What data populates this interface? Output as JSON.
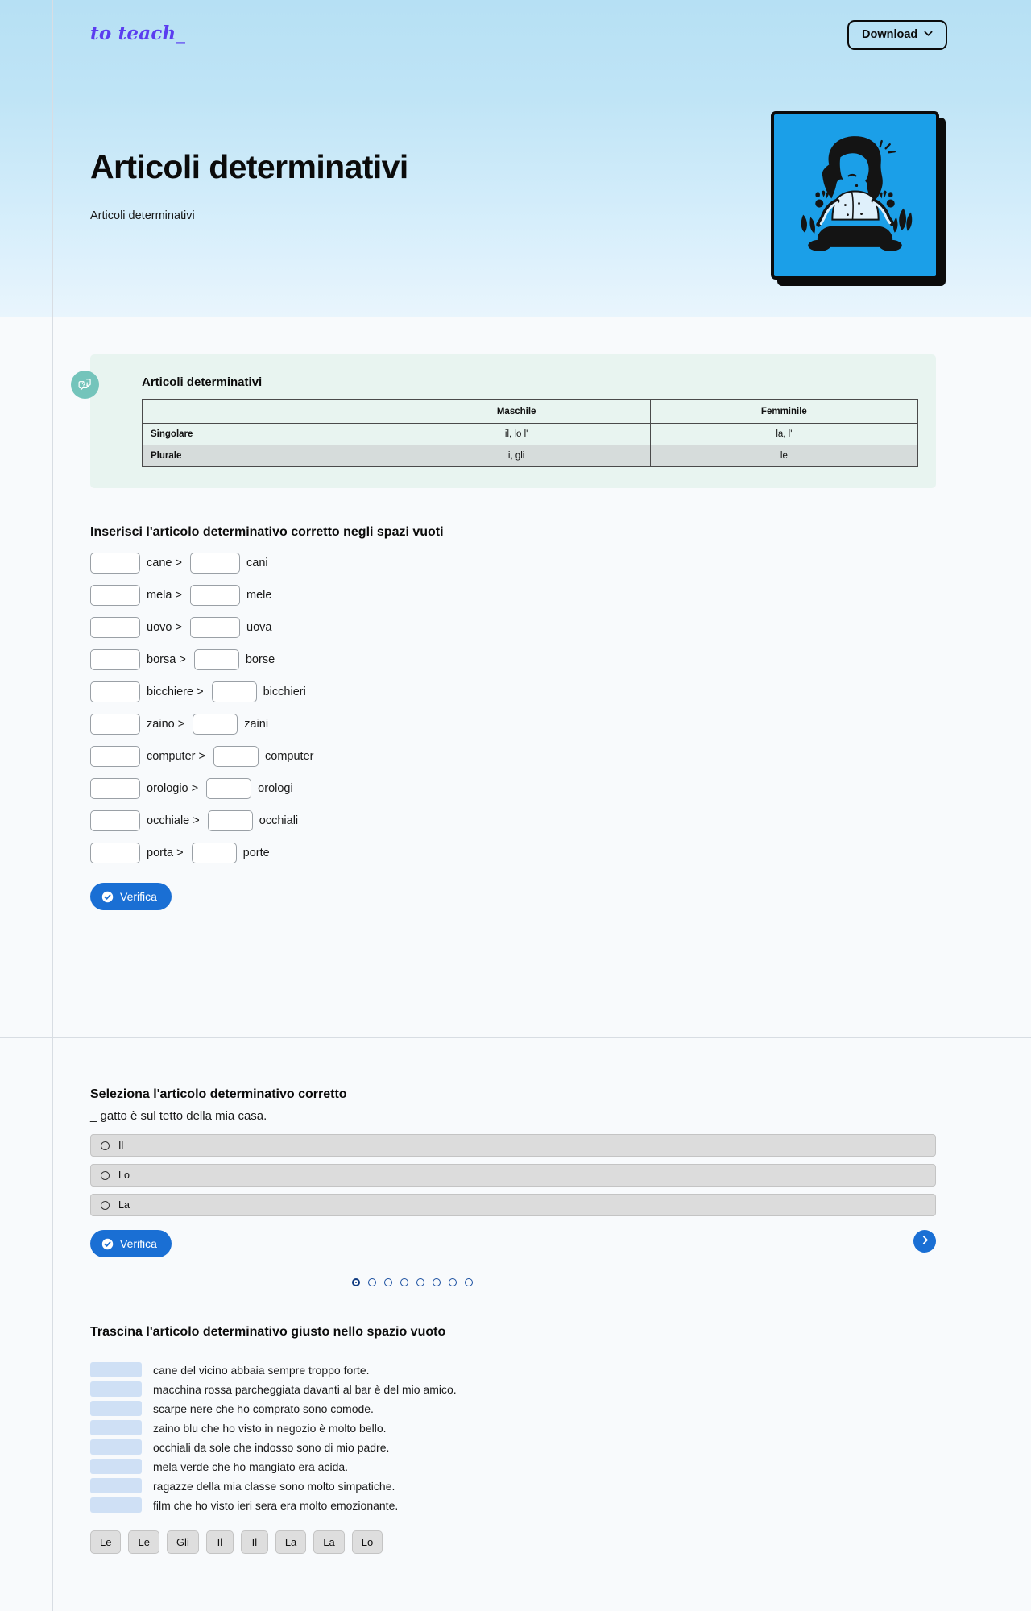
{
  "header": {
    "brand": "to teach_",
    "download_label": "Download",
    "download_icon": "chevron-down-icon",
    "title": "Articoli determinativi",
    "subtitle": "Articoli determinativi",
    "accent_color": "#5b3df0",
    "band_color": "#bfe4f6",
    "art_bg": "#1b9fe8"
  },
  "info_card": {
    "icon": "question-chat-icon",
    "title": "Articoli determinativi",
    "bg_color": "#e8f4f0",
    "table": {
      "columns": [
        "",
        "Maschile",
        "Femminile"
      ],
      "rows": [
        {
          "label": "Singolare",
          "cells": [
            "il, lo l'",
            "la, l'"
          ],
          "shaded": false
        },
        {
          "label": "Plurale",
          "cells": [
            "i, gli",
            "le"
          ],
          "shaded": true
        }
      ]
    }
  },
  "exercise_fill": {
    "title": "Inserisci l'articolo determinativo corretto negli spazi vuoti",
    "rows": [
      {
        "singular": "cane >",
        "plural": "cani"
      },
      {
        "singular": "mela >",
        "plural": "mele"
      },
      {
        "singular": "uovo >",
        "plural": "uova"
      },
      {
        "singular": "borsa >",
        "plural": "borse"
      },
      {
        "singular": "bicchiere >",
        "plural": "bicchieri"
      },
      {
        "singular": "zaino >",
        "plural": "zaini"
      },
      {
        "singular": "computer >",
        "plural": "computer"
      },
      {
        "singular": "orologio >",
        "plural": "orologi"
      },
      {
        "singular": "occhiale >",
        "plural": "occhiali"
      },
      {
        "singular": "porta >",
        "plural": "porte"
      }
    ],
    "verify_label": "Verifica",
    "verify_icon": "check-circle-icon",
    "input_value": "",
    "input_placeholder": ""
  },
  "exercise_choice": {
    "title": "Seleziona l'articolo determinativo corretto",
    "question": "_ gatto è sul tetto della mia casa.",
    "options": [
      "Il",
      "Lo",
      "La"
    ],
    "selected": null,
    "verify_label": "Verifica",
    "verify_icon": "check-circle-icon",
    "next_icon": "chevron-right-icon",
    "pagination": {
      "total": 8,
      "current": 1
    }
  },
  "exercise_drag": {
    "title": "Trascina l'articolo determinativo giusto nello spazio vuoto",
    "sentences": [
      "cane del vicino abbaia sempre troppo forte.",
      "macchina rossa parcheggiata davanti al bar è del mio amico.",
      "scarpe nere che ho comprato sono comode.",
      "zaino blu che ho visto in negozio è molto bello.",
      "occhiali da sole che indosso sono di mio padre.",
      "mela verde che ho mangiato era acida.",
      "ragazze della mia classe sono molto simpatiche.",
      "film che ho visto ieri sera era molto emozionante."
    ],
    "chips": [
      "Le",
      "Le",
      "Gli",
      "Il",
      "Il",
      "La",
      "La",
      "Lo"
    ]
  }
}
